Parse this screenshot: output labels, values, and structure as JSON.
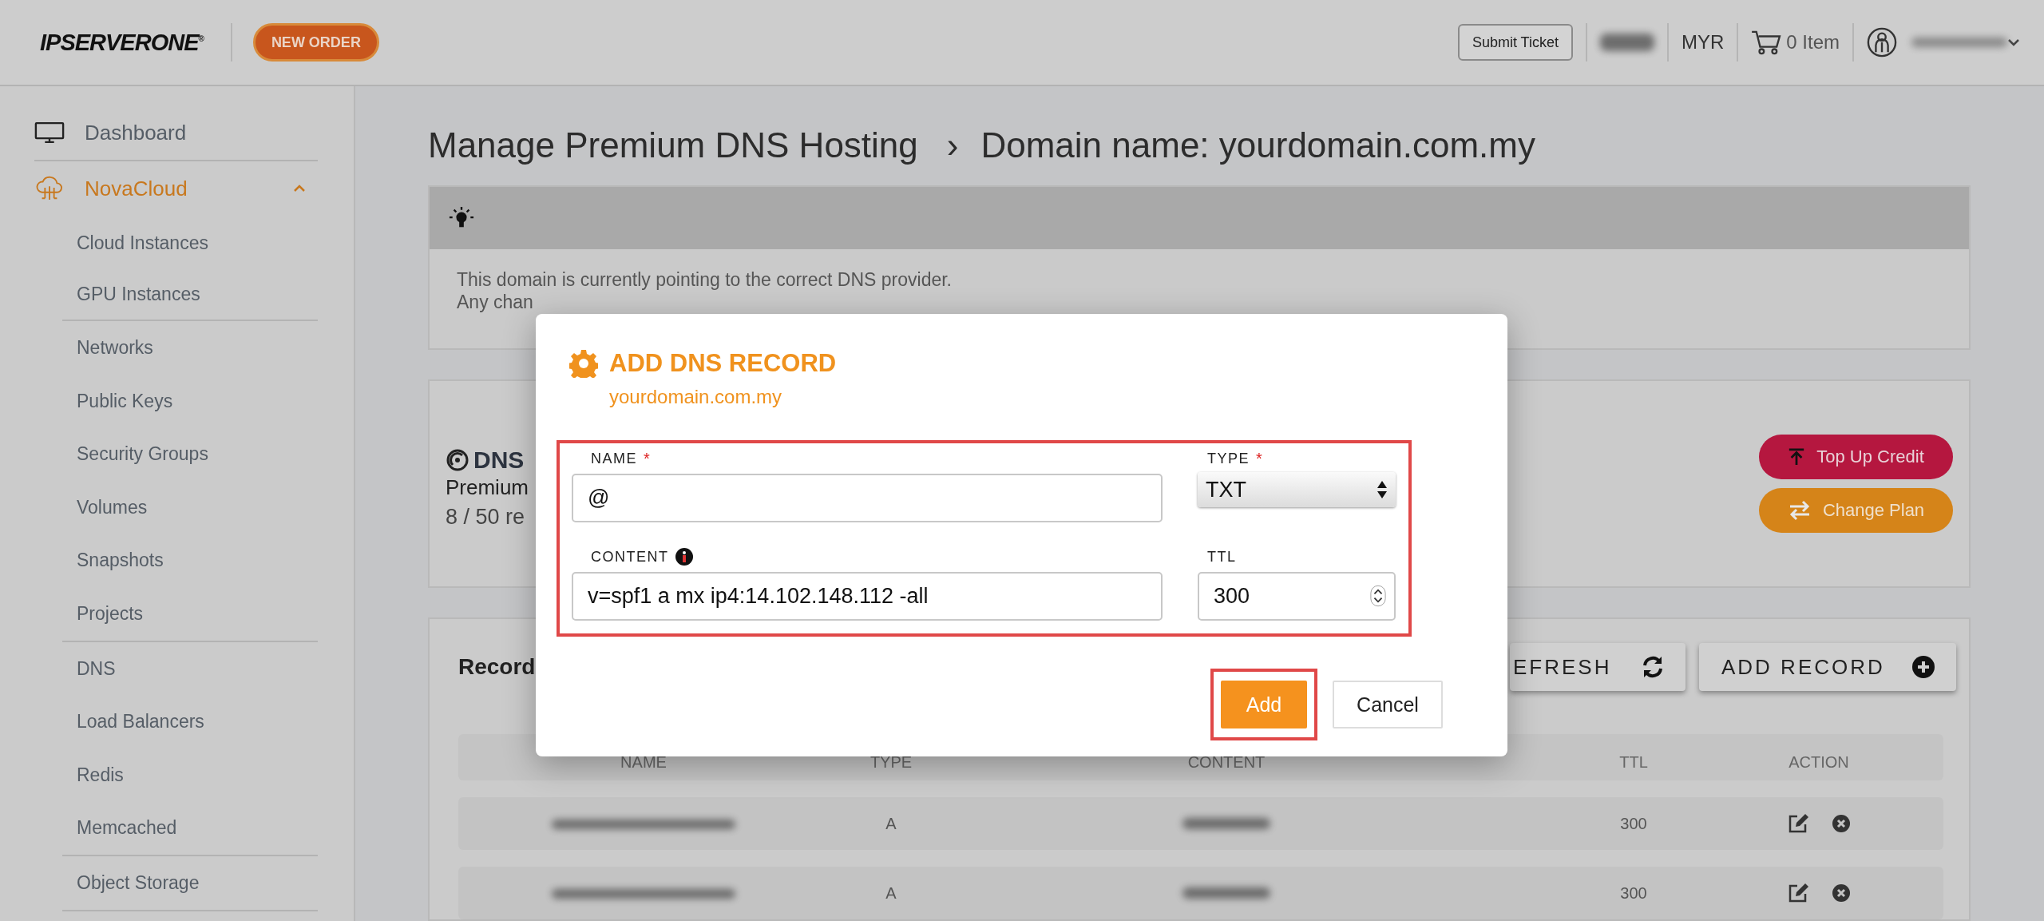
{
  "header": {
    "logo": "IPSERVERONE",
    "logo_mark": "®",
    "new_order": "NEW ORDER",
    "submit_ticket": "Submit Ticket",
    "account_blurred": true,
    "currency": "MYR",
    "cart": "0 Item",
    "user_blurred": true
  },
  "sidebar": {
    "items": [
      {
        "label": "Dashboard",
        "selected": false
      },
      {
        "label": "NovaCloud",
        "selected": true,
        "expanded": true,
        "sections": [
          {
            "items": [
              "Cloud Instances",
              "GPU Instances"
            ]
          },
          {
            "items": [
              "Networks",
              "Public Keys",
              "Security Groups",
              "Volumes",
              "Snapshots",
              "Projects"
            ]
          },
          {
            "items": [
              "DNS",
              "Load Balancers",
              "Redis",
              "Memcached"
            ]
          },
          {
            "items": [
              "Object Storage"
            ]
          }
        ]
      }
    ]
  },
  "page": {
    "title": "Manage Premium DNS Hosting",
    "separator": "›",
    "subtitle": "Domain name: yourdomain.com.my"
  },
  "alert": {
    "lines": [
      "This domain is currently pointing to the correct DNS provider.",
      "Any chan"
    ]
  },
  "dns_panel": {
    "title": "DNS",
    "plan": "Premium",
    "usage": "8 / 50 re",
    "buttons": [
      {
        "label": "Top Up Credit",
        "kind": "topup"
      },
      {
        "label": "Change Plan",
        "kind": "change"
      }
    ]
  },
  "records": {
    "title": "Record",
    "buttons": [
      {
        "label": "EFRESH",
        "kind": "refresh"
      },
      {
        "label": "ADD RECORD",
        "kind": "add"
      }
    ],
    "columns": [
      "NAME",
      "TYPE",
      "CONTENT",
      "TTL",
      "ACTION"
    ],
    "rows": [
      {
        "name_blurred": true,
        "type": "A",
        "content_blurred": true,
        "ttl": "300"
      },
      {
        "name_blurred": true,
        "type": "A",
        "content_blurred": true,
        "ttl": "300"
      }
    ]
  },
  "modal": {
    "title": "ADD DNS RECORD",
    "subtitle": "yourdomain.com.my",
    "highlighted": true,
    "fields": [
      {
        "kind": "text",
        "label": "NAME",
        "required_mark": "*",
        "value": "@"
      },
      {
        "kind": "select",
        "label": "TYPE",
        "required_mark": "*",
        "value": "TXT"
      },
      {
        "kind": "text",
        "label": "CONTENT",
        "info": true,
        "value": "v=spf1 a mx ip4:14.102.148.112 -all"
      },
      {
        "kind": "number",
        "label": "TTL",
        "value": "300"
      }
    ],
    "buttons": [
      {
        "label": "Add",
        "kind": "primary",
        "highlighted": true
      },
      {
        "label": "Cancel",
        "kind": "secondary",
        "highlighted": false
      }
    ]
  }
}
